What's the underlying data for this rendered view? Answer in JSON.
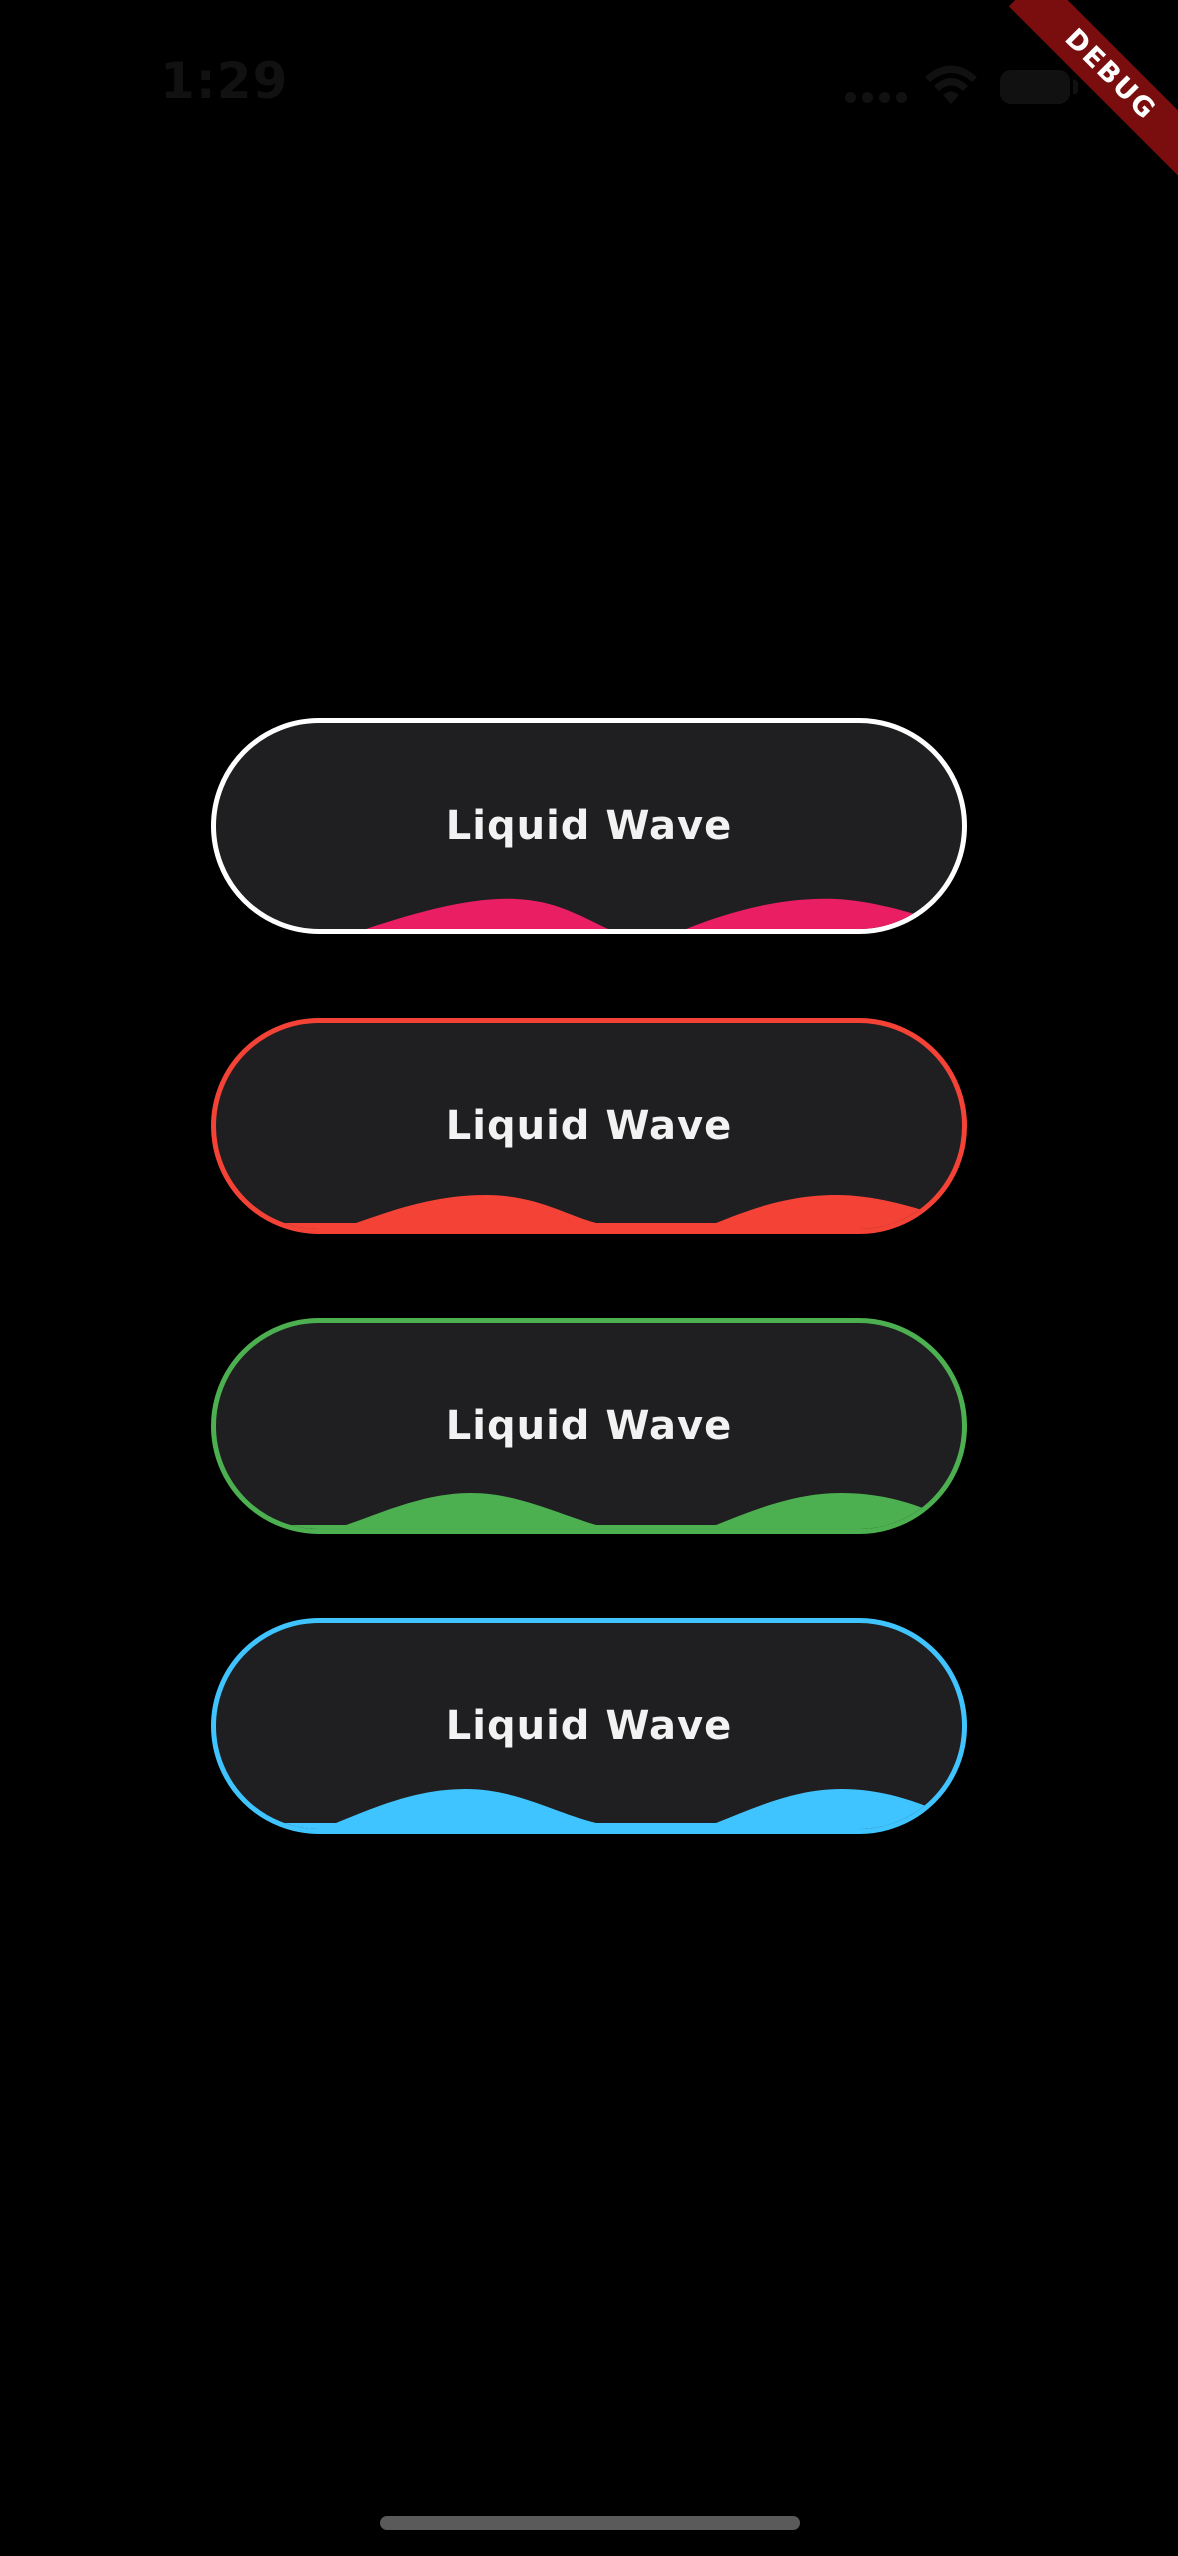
{
  "status_bar": {
    "time": "1:29"
  },
  "debug_banner": {
    "label": "DEBUG",
    "color": "#7a0e0f"
  },
  "buttons": [
    {
      "label": "Liquid Wave",
      "border_color": "#ffffff",
      "wave_color": "#e91e63"
    },
    {
      "label": "Liquid Wave",
      "border_color": "#f44336",
      "wave_color": "#f44336"
    },
    {
      "label": "Liquid Wave",
      "border_color": "#4caf50",
      "wave_color": "#4caf50"
    },
    {
      "label": "Liquid Wave",
      "border_color": "#40c4ff",
      "wave_color": "#40c4ff"
    }
  ],
  "colors": {
    "background": "#000000",
    "button_fill": "#1f1f21",
    "label_text": "#f2f2f2"
  }
}
